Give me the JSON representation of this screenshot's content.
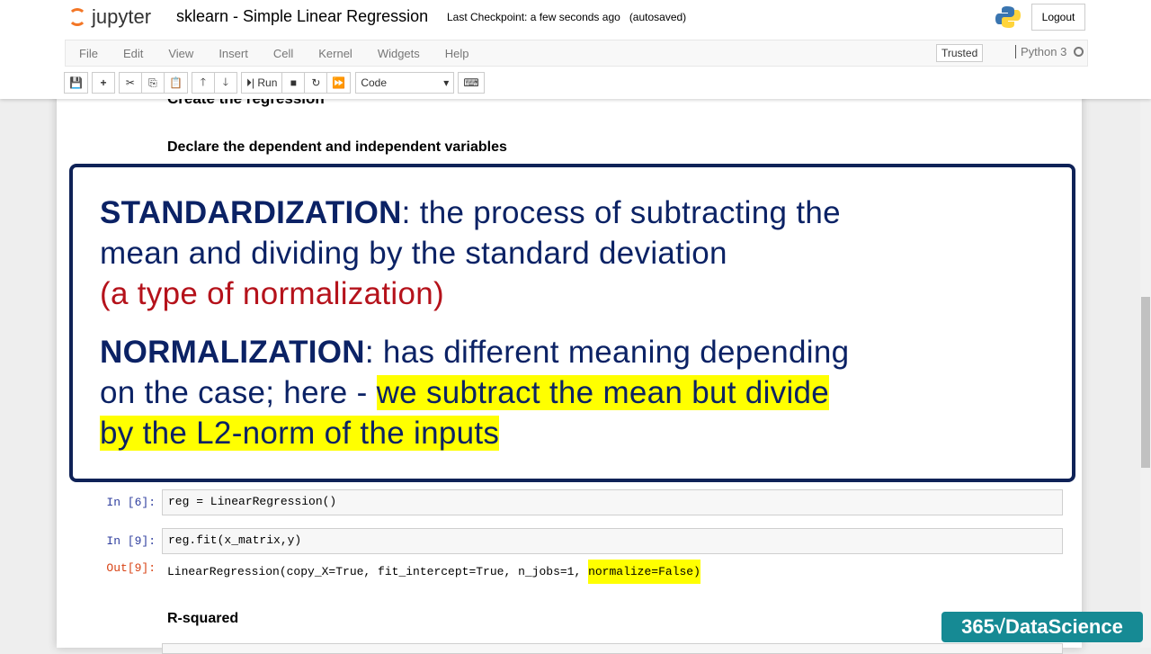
{
  "header": {
    "logo": "jupyter",
    "title": "sklearn - Simple Linear Regression",
    "checkpoint": "Last Checkpoint: a few seconds ago",
    "autosave": "(autosaved)",
    "logout": "Logout"
  },
  "menu": [
    "File",
    "Edit",
    "View",
    "Insert",
    "Cell",
    "Kernel",
    "Widgets",
    "Help"
  ],
  "trusted": "Trusted",
  "kernel": "Python 3",
  "toolbar": {
    "run": "Run",
    "cell_type": "Code"
  },
  "notebook": {
    "heading_clipped": "Create the regression",
    "heading1": "Declare the dependent and independent variables",
    "heading2": "R-squared"
  },
  "callout": {
    "term1": "STANDARDIZATION",
    "def1": ": the process of subtracting the",
    "def1b": "mean and dividing by the standard deviation",
    "note1": "(a type of normalization)",
    "term2": "NORMALIZATION",
    "def2": ": has different meaning depending",
    "def2b": "on the case; here - ",
    "hl1": "we subtract the mean but divide ",
    "hl2": "by the L2-norm of the inputs "
  },
  "cells": [
    {
      "prompt": "In [6]:",
      "code": "reg = LinearRegression()"
    },
    {
      "prompt": "In [9]:",
      "code": "reg.fit(x_matrix,y)"
    }
  ],
  "output": {
    "prompt": "Out[9]:",
    "text": "LinearRegression(copy_X=True, fit_intercept=True, n_jobs=1, ",
    "highlight": "normalize=False)"
  },
  "brand": "365√DataScience",
  "colors": {
    "navy": "#0b2265",
    "red": "#b5121b",
    "highlight": "#ffff00",
    "brand": "#168a94"
  }
}
